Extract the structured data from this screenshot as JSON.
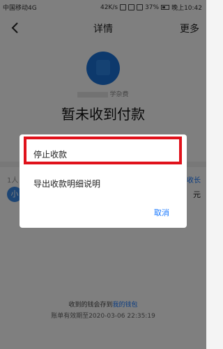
{
  "status_bar": {
    "carrier": "中国移动4G",
    "speed": "42K/s",
    "battery": "37%",
    "time": "晚上10:42"
  },
  "nav": {
    "title": "详情",
    "more": "更多"
  },
  "payment": {
    "payee_suffix": "学杂费",
    "status": "暂未收到付款"
  },
  "members": {
    "count_label_prefix": "1人",
    "expand_label": "收长",
    "avatar_text": "小",
    "amount_suffix": "元"
  },
  "footer": {
    "note_prefix": "收到的钱会存到",
    "wallet_link": "我的钱包",
    "expire": "账单有效期至2020-03-06 22:35:19"
  },
  "dialog": {
    "stop_label": "停止收款",
    "export_label": "导出收款明细说明",
    "cancel_label": "取消",
    "highlight_color": "#e0121b"
  }
}
